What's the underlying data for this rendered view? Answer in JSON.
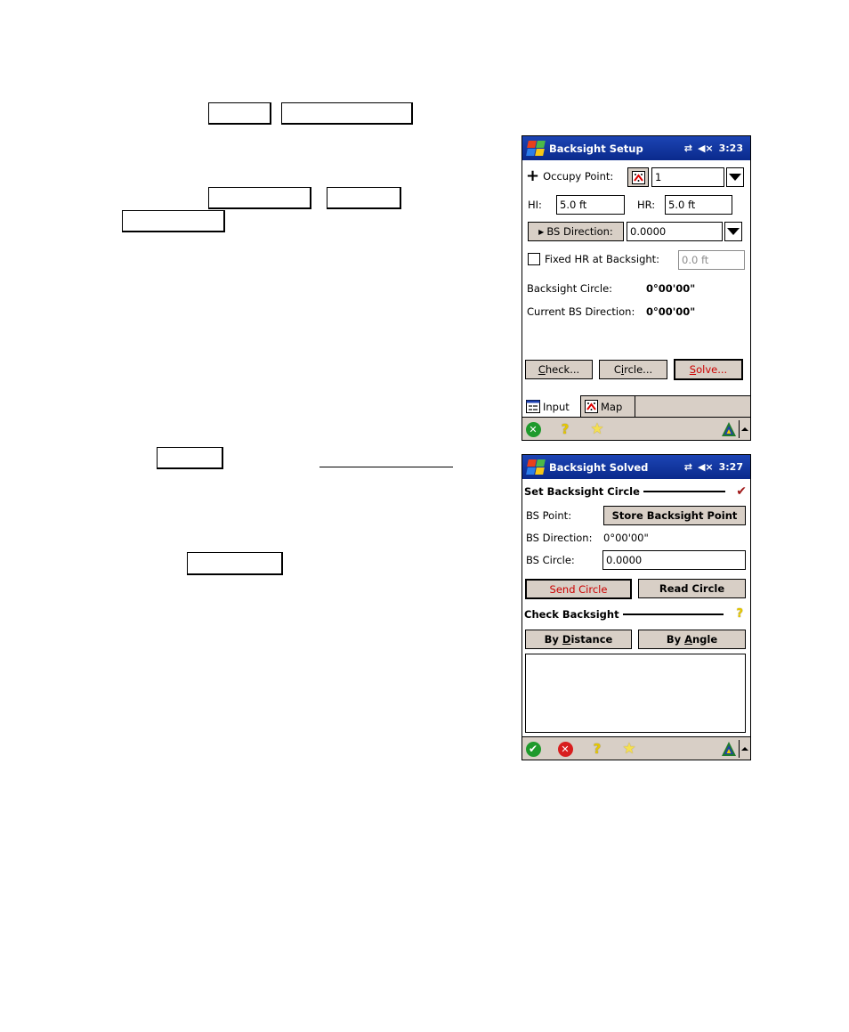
{
  "document": {
    "callouts": [
      "",
      "",
      "",
      "",
      "",
      "",
      ""
    ]
  },
  "screen1": {
    "title": "Backsight Setup",
    "status": {
      "sync_icon": "⇄",
      "volume_icon": "◀×",
      "time": "3:23"
    },
    "occupy_point": {
      "label": "Occupy Point:",
      "value": "1"
    },
    "hi": {
      "label": "HI:",
      "value": "5.0 ft"
    },
    "hr": {
      "label": "HR:",
      "value": "5.0 ft"
    },
    "bs_direction": {
      "button_label": "BS Direction:",
      "value": "0.0000"
    },
    "fixed_hr": {
      "label": "Fixed HR at Backsight:",
      "checked": false,
      "value": "0.0 ft"
    },
    "backsight_circle": {
      "label": "Backsight Circle:",
      "value": "0°00'00\""
    },
    "current_bs_direction": {
      "label": "Current BS Direction:",
      "value": "0°00'00\""
    },
    "buttons": {
      "check": {
        "mnemonic": "C",
        "rest": "heck..."
      },
      "circle": {
        "pre": "C",
        "mnemonic": "i",
        "rest": "rcle..."
      },
      "solve": {
        "mnemonic": "S",
        "rest": "olve..."
      }
    },
    "tabs": [
      {
        "label": "Input",
        "icon": "input-form-icon",
        "active": true
      },
      {
        "label": "Map",
        "icon": "map-icon",
        "active": false
      }
    ],
    "toolbar": [
      "close-icon",
      "help-icon",
      "favorites-icon"
    ]
  },
  "screen2": {
    "title": "Backsight Solved",
    "status": {
      "sync_icon": "⇄",
      "volume_icon": "◀×",
      "time": "3:27"
    },
    "set_section": {
      "title": "Set Backsight Circle",
      "status_icon": "checkmark-icon"
    },
    "bs_point": {
      "label": "BS Point:",
      "button_label": "Store Backsight Point"
    },
    "bs_direction": {
      "label": "BS Direction:",
      "value": "0°00'00\""
    },
    "bs_circle": {
      "label": "BS Circle:",
      "value": "0.0000"
    },
    "send_circle": "Send Circle",
    "read_circle": "Read Circle",
    "check_section": {
      "title": "Check Backsight",
      "status_icon": "help-icon"
    },
    "by_distance": {
      "pre": "By ",
      "mnemonic": "D",
      "rest": "istance"
    },
    "by_angle": {
      "pre": "By ",
      "mnemonic": "A",
      "rest": "ngle"
    },
    "notes": "",
    "toolbar": [
      "ok-icon",
      "cancel-icon",
      "help-icon",
      "favorites-icon"
    ]
  },
  "glyphs": {
    "plus": "+",
    "check_mark": "✔",
    "question": "?",
    "star": "★",
    "ok": "✔",
    "x": "✕",
    "play": "▶"
  }
}
